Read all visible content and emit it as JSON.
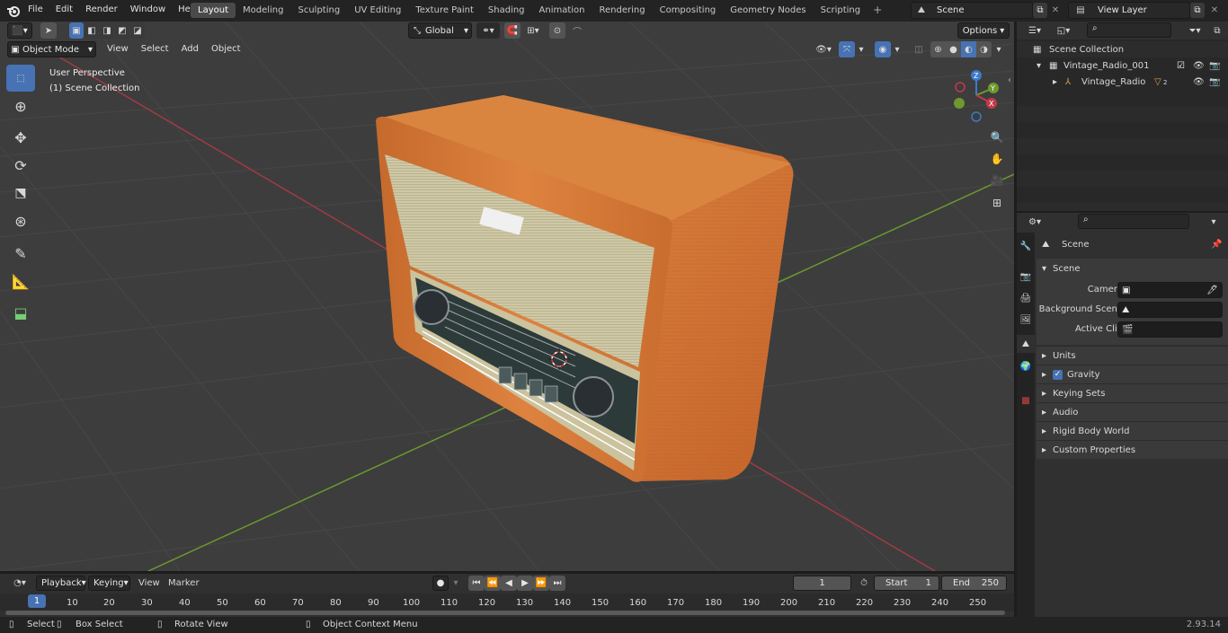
{
  "menu": [
    "File",
    "Edit",
    "Render",
    "Window",
    "Help"
  ],
  "workspaces": [
    "Layout",
    "Modeling",
    "Sculpting",
    "UV Editing",
    "Texture Paint",
    "Shading",
    "Animation",
    "Rendering",
    "Compositing",
    "Geometry Nodes",
    "Scripting"
  ],
  "active_workspace": "Layout",
  "scene_name": "Scene",
  "view_layer": "View Layer",
  "viewport": {
    "mode": "Object Mode",
    "menus": [
      "View",
      "Select",
      "Add",
      "Object"
    ],
    "transform": "Global",
    "options": "Options",
    "overlay_line1": "User Perspective",
    "overlay_line2": "(1) Scene Collection"
  },
  "gizmo": {
    "z": "Z",
    "y": "Y",
    "x": "X"
  },
  "outliner": {
    "root": "Scene Collection",
    "collection": "Vintage_Radio_001",
    "object": "Vintage_Radio",
    "badge": "2"
  },
  "properties": {
    "context": "Scene",
    "section": "Scene",
    "fields": [
      {
        "label": "Camera"
      },
      {
        "label": "Background Scene"
      },
      {
        "label": "Active Clip"
      }
    ],
    "panels": [
      "Units",
      "Gravity",
      "Keying Sets",
      "Audio",
      "Rigid Body World",
      "Custom Properties"
    ]
  },
  "timeline": {
    "menus": [
      "Playback",
      "Keying",
      "View",
      "Marker"
    ],
    "current": "1",
    "start_label": "Start",
    "start": "1",
    "end_label": "End",
    "end": "250",
    "ticks": [
      "1",
      "10",
      "20",
      "30",
      "40",
      "50",
      "60",
      "70",
      "80",
      "90",
      "100",
      "110",
      "120",
      "130",
      "140",
      "150",
      "160",
      "170",
      "180",
      "190",
      "200",
      "210",
      "220",
      "230",
      "240",
      "250"
    ]
  },
  "status": {
    "select": "Select",
    "box_select": "Box Select",
    "rotate": "Rotate View",
    "context": "Object Context Menu",
    "version": "2.93.14"
  },
  "colors": {
    "accent": "#4772b3",
    "bg": "#1d1d1d",
    "header": "#303030",
    "viewport": "#3d3d3d",
    "x_axis": "#a03a45",
    "y_axis": "#6c9a2e",
    "wood": "#d87a33"
  }
}
